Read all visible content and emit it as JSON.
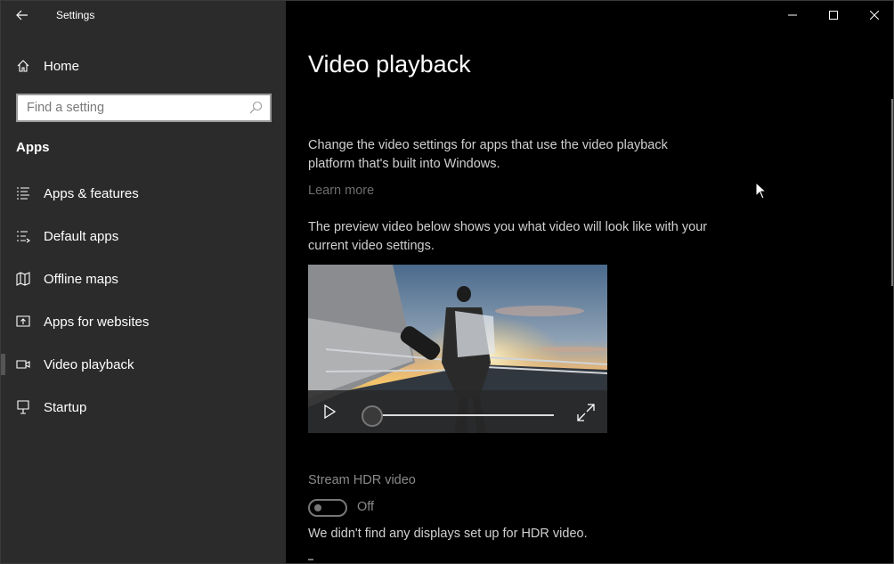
{
  "window": {
    "title": "Settings"
  },
  "sidebar": {
    "home_label": "Home",
    "search": {
      "placeholder": "Find a setting"
    },
    "section_title": "Apps",
    "items": [
      {
        "label": "Apps & features",
        "icon": "apps-features-icon"
      },
      {
        "label": "Default apps",
        "icon": "default-apps-icon"
      },
      {
        "label": "Offline maps",
        "icon": "offline-maps-icon"
      },
      {
        "label": "Apps for websites",
        "icon": "apps-for-websites-icon"
      },
      {
        "label": "Video playback",
        "icon": "video-camera-icon",
        "selected": true
      },
      {
        "label": "Startup",
        "icon": "startup-icon"
      }
    ]
  },
  "main": {
    "page_title": "Video playback",
    "description": "Change the video settings for apps that use the video playback platform that's built into Windows.",
    "learn_more": "Learn more",
    "preview_description": "The preview video below shows you what video will look like with your current video settings.",
    "video": {
      "progress": 0.0
    },
    "hdr": {
      "label": "Stream HDR video",
      "toggle_state": "Off",
      "note": "We didn't find any displays set up for HDR video."
    }
  },
  "colors": {
    "sidebar_bg": "#2b2b2b",
    "main_bg": "#000000",
    "muted_text": "#8a8a8a"
  }
}
